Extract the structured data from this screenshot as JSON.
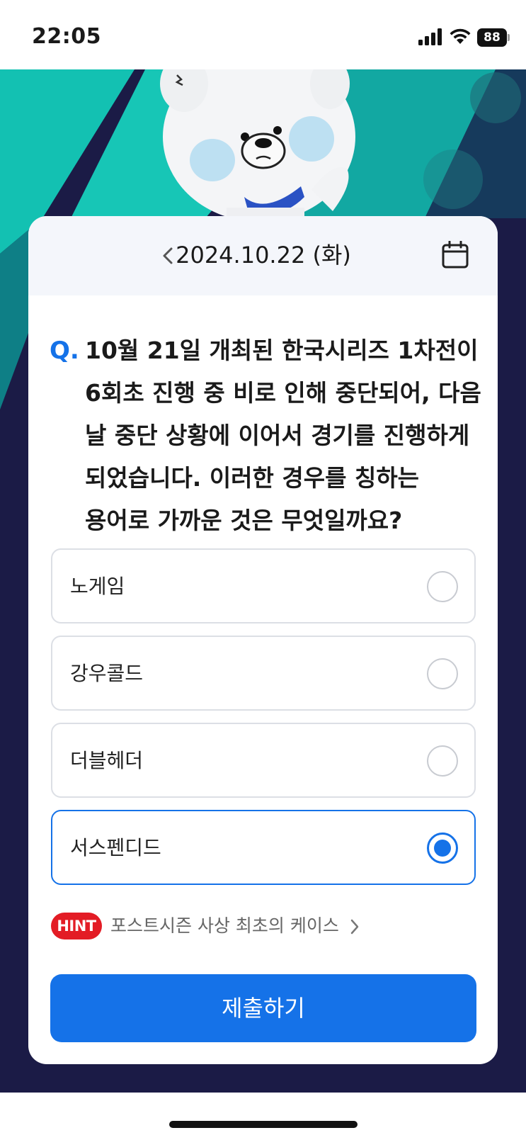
{
  "status_bar": {
    "time": "22:05",
    "battery": "88",
    "icons": [
      "signal-icon",
      "wifi-icon",
      "battery-icon"
    ]
  },
  "hero": {
    "mascot": "polar-bear-mascot",
    "colors": {
      "teal": "#15c4b4",
      "navy": "#1b1b46"
    }
  },
  "quiz": {
    "date": "2024.10.22 (화)",
    "question_mark": "Q.",
    "question": "10월 21일 개최된 한국시리즈 1차전이 6회초 진행 중 비로 인해 중단되어, 다음 날 중단 상황에 이어서 경기를 진행하게 되었습니다. 이러한 경우를 칭하는 용어로 가까운 것은 무엇일까요?",
    "options": [
      {
        "label": "노게임",
        "selected": false
      },
      {
        "label": "강우콜드",
        "selected": false
      },
      {
        "label": "더블헤더",
        "selected": false
      },
      {
        "label": "서스펜디드",
        "selected": true
      }
    ],
    "hint_badge": "HINT",
    "hint_text": "포스트시즌 사상 최초의 케이스",
    "submit_label": "제출하기"
  },
  "colors": {
    "accent": "#1572e8",
    "hint_red": "#e31c25"
  }
}
